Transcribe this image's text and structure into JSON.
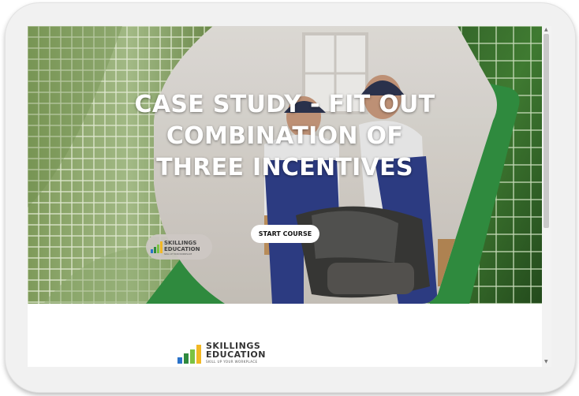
{
  "course": {
    "title": "CASE STUDY - FIT OUT COMBINATION OF THREE INCENTIVES",
    "start_button": "START COURSE"
  },
  "brand": {
    "name_line1": "SKILLINGS",
    "name_line2": "EDUCATION",
    "tagline": "SKILL UP YOUR WORKPLACE",
    "colors": {
      "dark_green": "#2f8a3e",
      "light_green": "#7cc242",
      "yellow": "#f2b824",
      "blue": "#2a72c9"
    }
  },
  "scrollbar": {
    "up_icon": "▲",
    "down_icon": "▼"
  }
}
